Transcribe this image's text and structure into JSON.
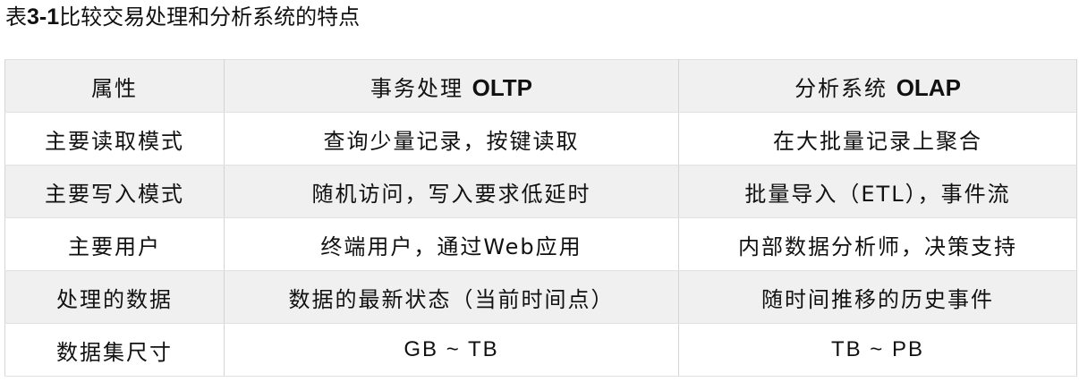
{
  "caption": {
    "prefix": "表",
    "number": "3-1",
    "text": "比较交易处理和分析系统的特点"
  },
  "table": {
    "header": {
      "attribute": "属性",
      "oltp_name": "事务处理",
      "oltp_abbr": "OLTP",
      "olap_name": "分析系统",
      "olap_abbr": "OLAP"
    },
    "rows": [
      {
        "attribute": "主要读取模式",
        "oltp": "查询少量记录，按键读取",
        "olap": "在大批量记录上聚合"
      },
      {
        "attribute": "主要写入模式",
        "oltp": "随机访问，写入要求低延时",
        "olap": "批量导入（ETL），事件流"
      },
      {
        "attribute": "主要用户",
        "oltp": "终端用户，通过Web应用",
        "olap": "内部数据分析师，决策支持"
      },
      {
        "attribute": "处理的数据",
        "oltp": "数据的最新状态（当前时间点）",
        "olap": "随时间推移的历史事件"
      },
      {
        "attribute": "数据集尺寸",
        "oltp": "GB ~ TB",
        "olap": "TB ~ PB"
      }
    ]
  },
  "colors": {
    "shaded_row": "#f0f0f0",
    "border": "#d4d4d4",
    "text": "#111111"
  }
}
